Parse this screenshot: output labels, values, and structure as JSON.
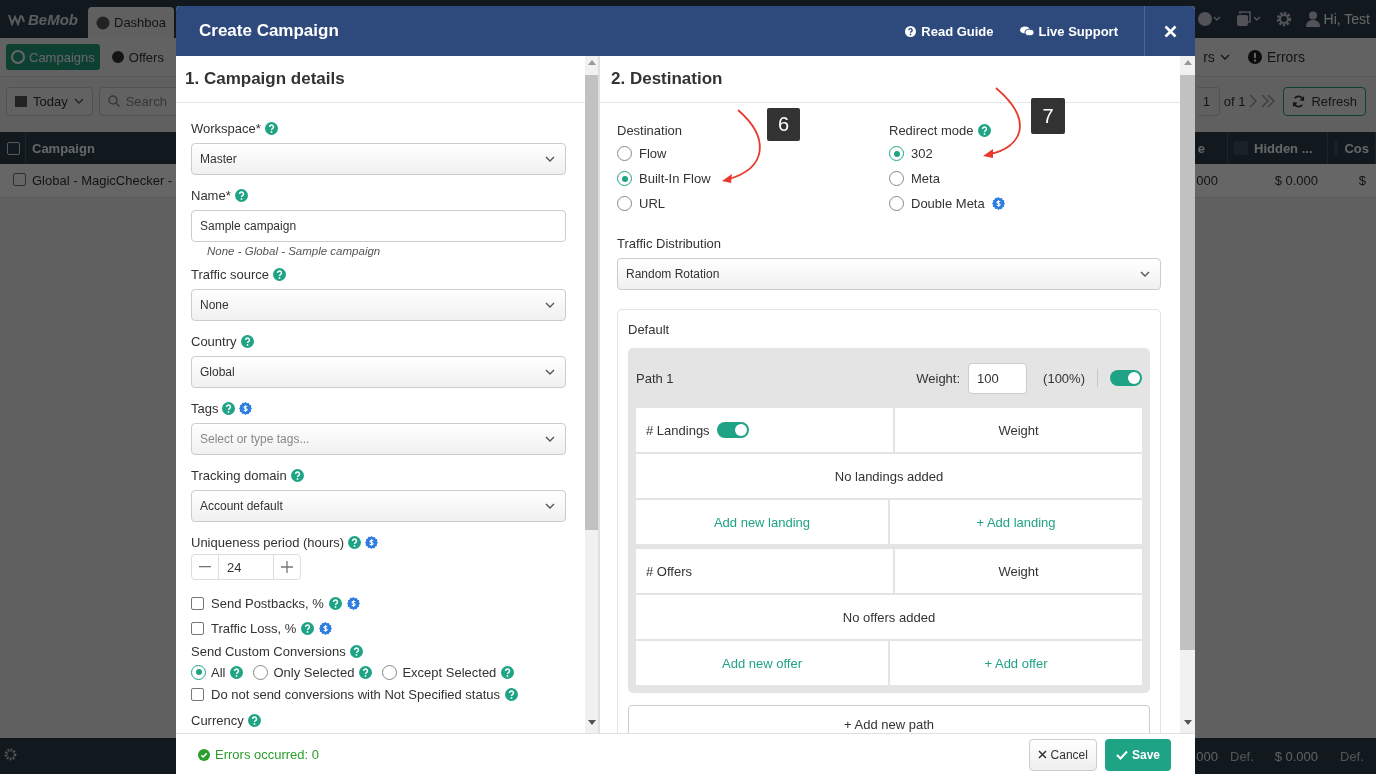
{
  "app": {
    "logo": "BeMob",
    "tabs": [
      {
        "label": "Dashboa",
        "selected": true
      }
    ],
    "user": "Hi, Test",
    "nav": [
      {
        "label": "Campaigns",
        "selected": true
      },
      {
        "label": "Offers",
        "selected": false
      }
    ],
    "nav_right": [
      {
        "label": "rs",
        "kind": "dropdown"
      },
      {
        "label": "Errors",
        "kind": "link"
      }
    ],
    "toolbar": {
      "date": "Today",
      "search_placeholder": "Search",
      "page": "1",
      "page_of": "of 1",
      "refresh": "Refresh"
    },
    "table": {
      "all_checked": false,
      "columns": [
        "Campaign",
        "e",
        "Hidden ...",
        "Cos"
      ],
      "rows": [
        {
          "checked": false,
          "cells": [
            "Global - MagicChecker -",
            "000",
            "$ 0.000",
            "$"
          ]
        }
      ]
    },
    "totals": [
      "000",
      "Def.",
      "$ 0.000",
      "Def."
    ]
  },
  "modal": {
    "title": "Create Campaign",
    "links": [
      {
        "label": "Read Guide",
        "kind": "guide"
      },
      {
        "label": "Live Support",
        "kind": "chat"
      }
    ],
    "details": {
      "heading": "1. Campaign details",
      "fields": [
        {
          "kind": "select",
          "label": "Workspace*",
          "help": true,
          "value": "Master"
        },
        {
          "kind": "text",
          "label": "Name*",
          "help": true,
          "value": "Sample campaign",
          "hint": "None - Global - Sample campaign"
        },
        {
          "kind": "select",
          "label": "Traffic source",
          "help": true,
          "value": "None"
        },
        {
          "kind": "select",
          "label": "Country",
          "help": true,
          "value": "Global"
        },
        {
          "kind": "select",
          "label": "Tags",
          "help": true,
          "paid": true,
          "placeholder": "Select or type tags..."
        },
        {
          "kind": "select",
          "label": "Tracking domain",
          "help": true,
          "value": "Account default"
        },
        {
          "kind": "stepper",
          "label": "Uniqueness period (hours)",
          "help": true,
          "paid": true,
          "value": "24"
        },
        {
          "kind": "checkbox",
          "label": "Send Postbacks, %",
          "checked": false,
          "help": true,
          "paid": true
        },
        {
          "kind": "checkbox",
          "label": "Traffic Loss, %",
          "checked": false,
          "help": true,
          "paid": true
        },
        {
          "kind": "radios",
          "label": "Send Custom Conversions",
          "help": true,
          "options": [
            {
              "label": "All",
              "selected": true,
              "help": true
            },
            {
              "label": "Only Selected",
              "selected": false,
              "help": true
            },
            {
              "label": "Except Selected",
              "selected": false,
              "help": true
            }
          ]
        },
        {
          "kind": "checkbox",
          "label": "Do not send conversions with Not Specified status",
          "checked": false,
          "help": true
        },
        {
          "kind": "heading",
          "label": "Currency",
          "help": true
        }
      ]
    },
    "destination": {
      "heading": "2. Destination",
      "groups": [
        {
          "label": "Destination",
          "options": [
            {
              "label": "Flow",
              "selected": false
            },
            {
              "label": "Built-In Flow",
              "selected": true
            },
            {
              "label": "URL",
              "selected": false
            }
          ]
        },
        {
          "label": "Redirect mode",
          "help": true,
          "options": [
            {
              "label": "302",
              "selected": true
            },
            {
              "label": "Meta",
              "selected": false
            },
            {
              "label": "Double Meta",
              "selected": false,
              "paid": true
            }
          ]
        }
      ],
      "distribution": {
        "label": "Traffic Distribution",
        "value": "Random Rotation"
      },
      "default": {
        "title": "Default",
        "paths": [
          {
            "name": "Path 1",
            "weight_label": "Weight:",
            "weight": "100",
            "share": "(100%)",
            "on": true,
            "tables": [
              {
                "title": "# Landings",
                "on": true,
                "weight_label": "Weight",
                "empty": "No landings added",
                "actions": [
                  "Add new landing",
                  "+ Add landing"
                ]
              },
              {
                "title": "# Offers",
                "weight_label": "Weight",
                "empty": "No offers added",
                "actions": [
                  "Add new offer",
                  "+ Add offer"
                ]
              }
            ]
          }
        ],
        "add_path": "+ Add new path"
      }
    },
    "footer": {
      "status": "Errors occurred: 0",
      "buttons": [
        {
          "label": "Cancel",
          "kind": "cancel"
        },
        {
          "label": "Save",
          "kind": "save"
        }
      ]
    }
  },
  "annotations": [
    {
      "label": "6"
    },
    {
      "label": "7"
    }
  ]
}
